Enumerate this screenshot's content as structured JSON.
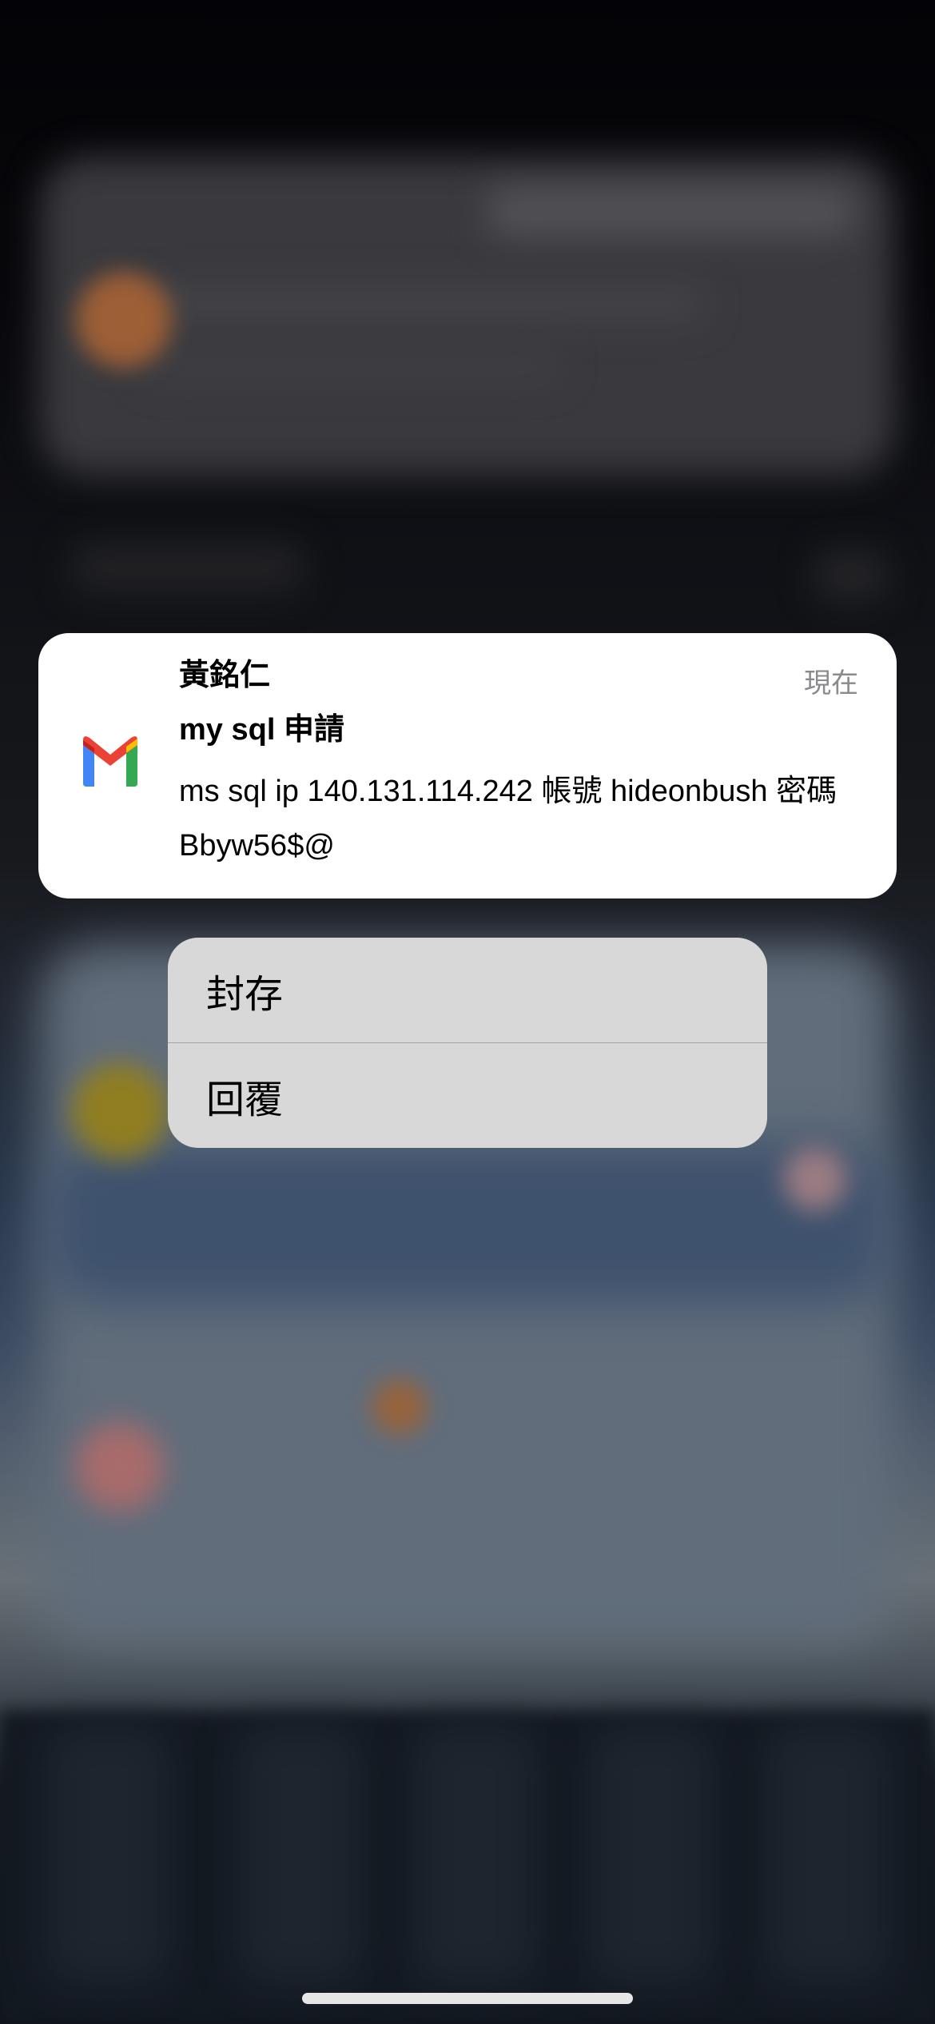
{
  "notification": {
    "app_icon": "gmail-icon",
    "sender": "黃銘仁",
    "timestamp": "現在",
    "subject": "my sql 申請",
    "body": "ms sql ip 140.131.114.242 帳號 hideonbush 密碼 Bbyw56$@"
  },
  "context_menu": {
    "items": [
      {
        "label": "封存"
      },
      {
        "label": "回覆"
      }
    ]
  },
  "colors": {
    "gmail_red": "#EA4335",
    "gmail_blue": "#4285F4",
    "gmail_green": "#34A853",
    "gmail_yellow": "#FBBC04",
    "menu_background": "#D8D8D8",
    "timestamp_gray": "#8A8A8E"
  }
}
